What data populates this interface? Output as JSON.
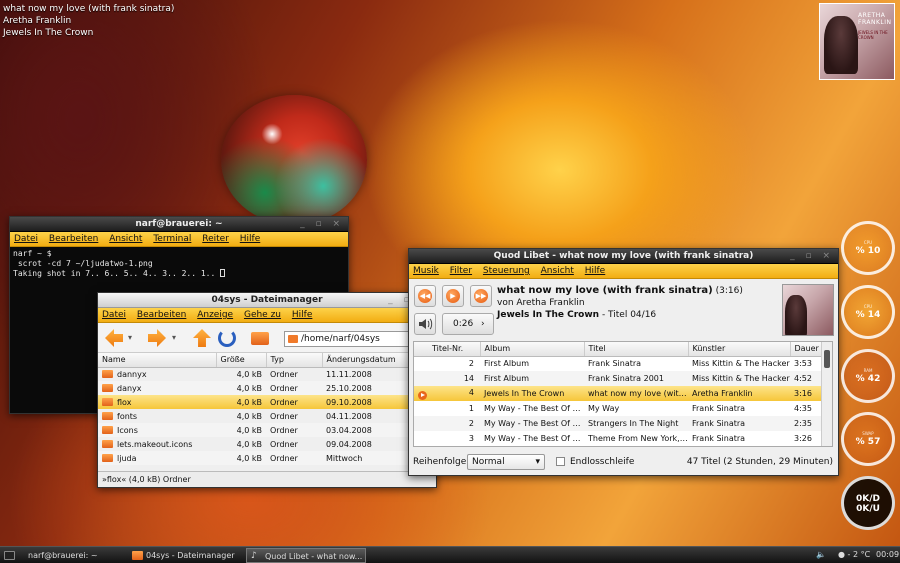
{
  "desktop_np": {
    "title": "what now my love (with frank sinatra)",
    "artist": "Aretha Franklin",
    "album": "Jewels In The Crown"
  },
  "cover_desktop": {
    "artist_text": "ARETHA FRANKLIN",
    "album_text": "JEWELS IN THE CROWN"
  },
  "terminal": {
    "title": "narf@brauerei: ~",
    "menu": [
      "Datei",
      "Bearbeiten",
      "Ansicht",
      "Terminal",
      "Reiter",
      "Hilfe"
    ],
    "lines": [
      "narf ~ $",
      " scrot -cd 7 ~/ljudatwo-1.png",
      "Taking shot in 7.. 6.. 5.. 4.. 3.. 2.. 1.. "
    ]
  },
  "filemanager": {
    "title": "04sys - Dateimanager",
    "menu": [
      "Datei",
      "Bearbeiten",
      "Anzeige",
      "Gehe zu",
      "Hilfe"
    ],
    "location": "/home/narf/04sys",
    "columns": [
      "Name",
      "Größe",
      "Typ",
      "Änderungsdatum"
    ],
    "rows": [
      {
        "name": "dannyx",
        "size": "4,0 kB",
        "type": "Ordner",
        "date": "11.11.2008"
      },
      {
        "name": "danyx",
        "size": "4,0 kB",
        "type": "Ordner",
        "date": "25.10.2008"
      },
      {
        "name": "flox",
        "size": "4,0 kB",
        "type": "Ordner",
        "date": "09.10.2008"
      },
      {
        "name": "fonts",
        "size": "4,0 kB",
        "type": "Ordner",
        "date": "04.11.2008"
      },
      {
        "name": "Icons",
        "size": "4,0 kB",
        "type": "Ordner",
        "date": "03.04.2008"
      },
      {
        "name": "lets.makeout.icons",
        "size": "4,0 kB",
        "type": "Ordner",
        "date": "09.04.2008"
      },
      {
        "name": "ljuda",
        "size": "4,0 kB",
        "type": "Ordner",
        "date": "Mittwoch"
      }
    ],
    "status": "»flox« (4,0 kB) Ordner"
  },
  "quodlibet": {
    "title": "Quod Libet - what now my love (with frank sinatra)",
    "menu": [
      "Musik",
      "Filter",
      "Steuerung",
      "Ansicht",
      "Hilfe"
    ],
    "song_title": "what now my love (with frank sinatra)",
    "song_length": "(3:16)",
    "by": "von Aretha Franklin",
    "album": "Jewels In The Crown",
    "track_info": "- Titel 04/16",
    "position": "0:26",
    "columns": [
      "Titel-Nr.",
      "Album",
      "Titel",
      "Künstler",
      "Dauer"
    ],
    "rows": [
      {
        "num": "2",
        "album": "First Album",
        "title": "Frank Sinatra",
        "artist": "Miss Kittin & The Hacker",
        "length": "3:53"
      },
      {
        "num": "14",
        "album": "First Album",
        "title": "Frank Sinatra 2001",
        "artist": "Miss Kittin & The Hacker",
        "length": "4:52"
      },
      {
        "num": "4",
        "album": "Jewels In The Crown",
        "title": "what now my love (with frank sinatra)",
        "artist": "Aretha Franklin",
        "length": "3:16"
      },
      {
        "num": "1",
        "album": "My Way - The Best Of Frank Sinatra",
        "title": "My Way",
        "artist": "Frank Sinatra",
        "length": "4:35"
      },
      {
        "num": "2",
        "album": "My Way - The Best Of Frank Sinatra",
        "title": "Strangers In The Night",
        "artist": "Frank Sinatra",
        "length": "2:35"
      },
      {
        "num": "3",
        "album": "My Way - The Best Of Frank Sinatra",
        "title": "Theme From New York, New York",
        "artist": "Frank Sinatra",
        "length": "3:26"
      }
    ],
    "order_label": "Reihenfolge:",
    "order_value": "Normal",
    "repeat_label": "Endlosschleife",
    "summary": "47 Titel (2 Stunden, 29 Minuten)"
  },
  "gauges": [
    {
      "label": "CPU",
      "value": "% 10"
    },
    {
      "label": "CPU",
      "value": "% 14"
    },
    {
      "label": "RAM",
      "value": "% 42"
    },
    {
      "label": "SWAP",
      "value": "% 57"
    },
    {
      "label": "",
      "value": "0K/D"
    }
  ],
  "gauge_net_up": "0K/U",
  "taskbar": {
    "tasks": [
      "narf@brauerei: ~",
      "04sys - Dateimanager",
      "Quod Libet - what now..."
    ],
    "temperature": "- 2 °C",
    "clock": "00:09"
  },
  "colors": {
    "accent": "#f2ad12",
    "selection": "#f6c63a",
    "play_orange": "#e8661a"
  }
}
